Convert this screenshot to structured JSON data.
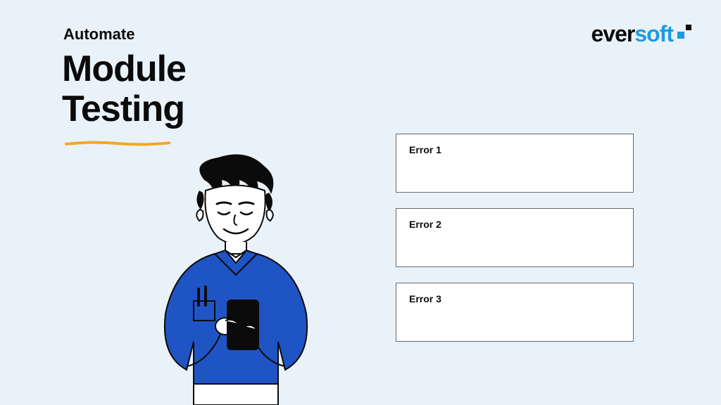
{
  "logo": {
    "part1": "ever",
    "part2": "soft"
  },
  "kicker": "Automate",
  "title_line1": "Module",
  "title_line2": "Testing",
  "errors": [
    {
      "label": "Error 1"
    },
    {
      "label": "Error 2"
    },
    {
      "label": "Error 3"
    }
  ],
  "colors": {
    "background": "#e9f2f8",
    "accent": "#1b9be3",
    "underline": "#f5a623",
    "text": "#0b0b0b"
  }
}
